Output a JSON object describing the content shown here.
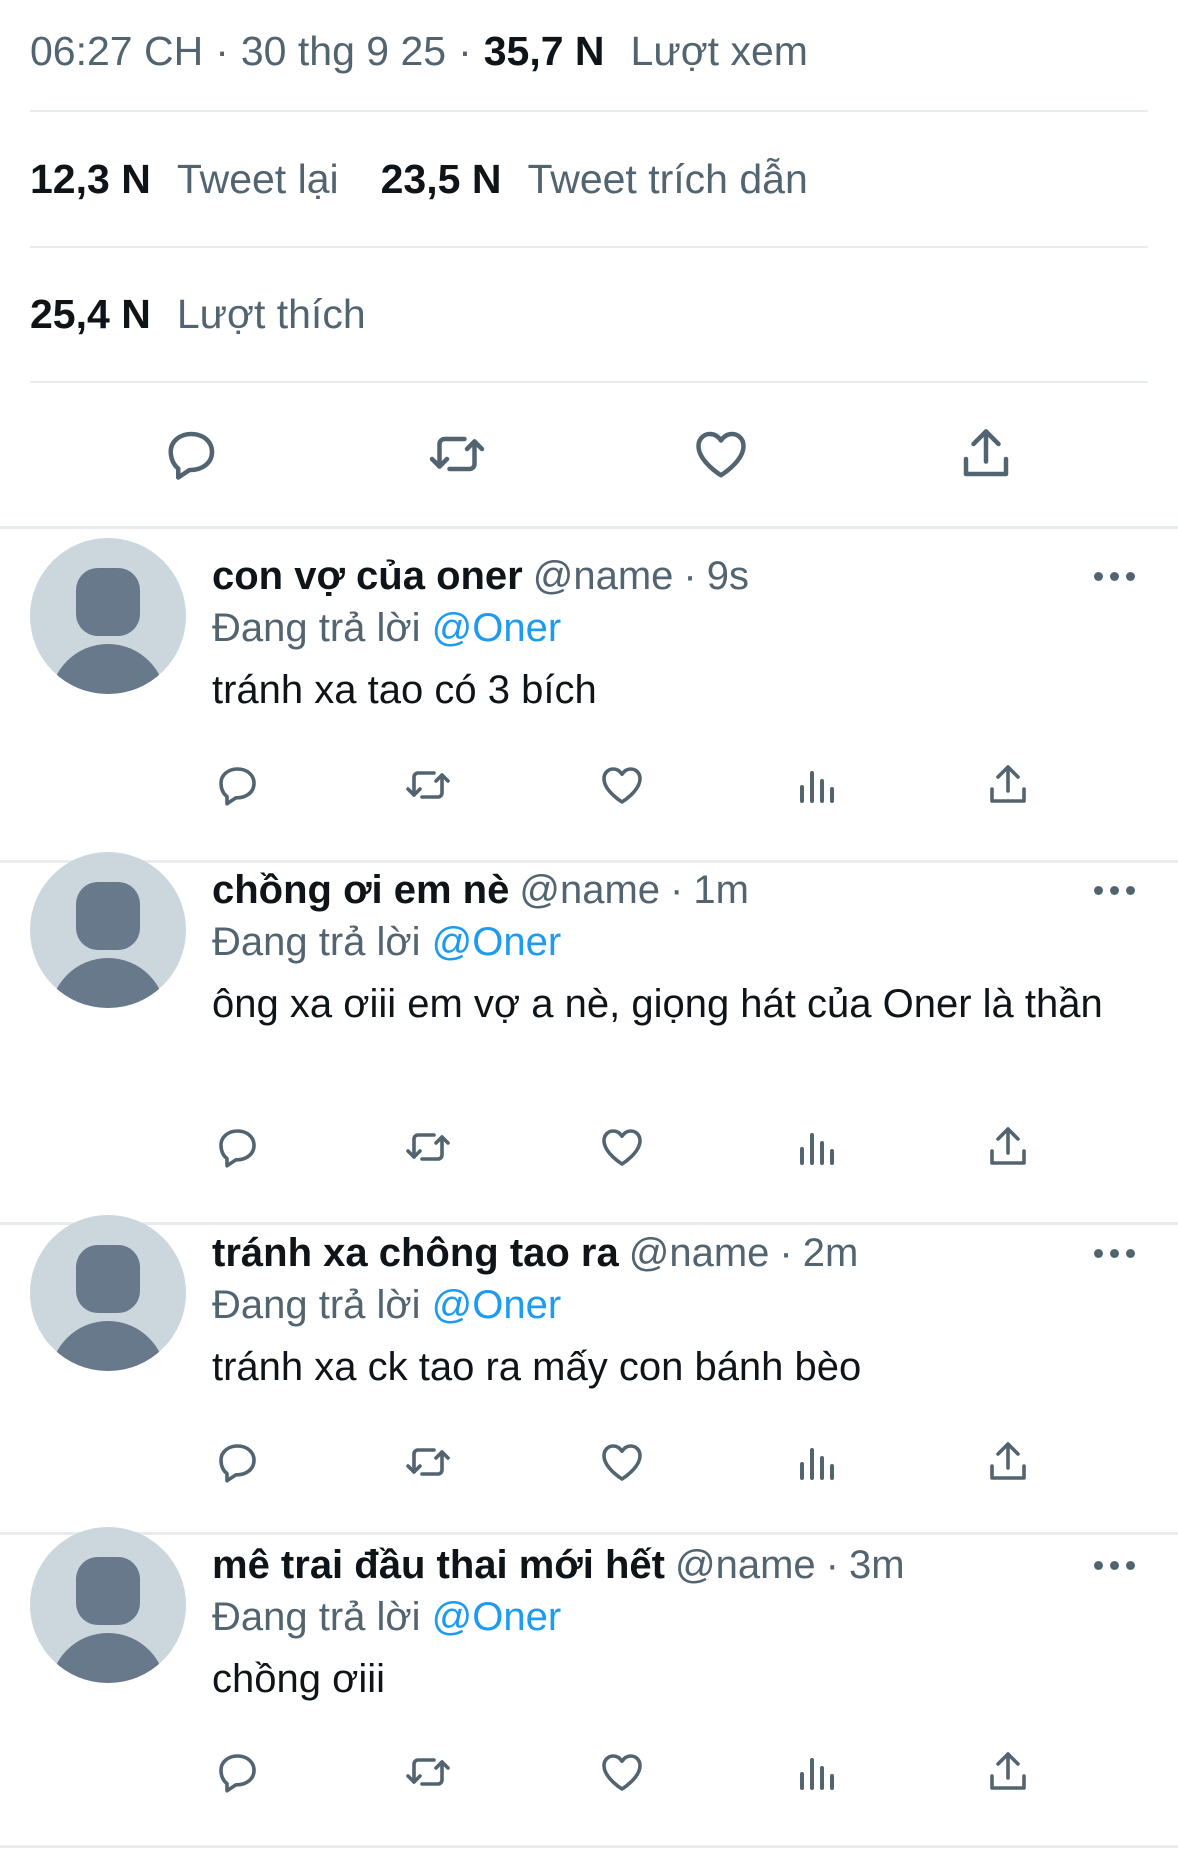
{
  "tweet_meta": {
    "time": "06:27 CH",
    "separator": "·",
    "date": "30 thg 9 25",
    "views_count": "35,7 N",
    "views_label": "Lượt xem"
  },
  "stats": {
    "retweets_count": "12,3 N",
    "retweets_label": "Tweet lại",
    "quotes_count": "23,5 N",
    "quotes_label": "Tweet trích dẫn",
    "likes_count": "25,4 N",
    "likes_label": "Lượt thích"
  },
  "icons": {
    "reply": "reply-icon",
    "retweet": "retweet-icon",
    "like": "heart-icon",
    "views": "analytics-icon",
    "share": "share-icon",
    "more": "more-icon"
  },
  "colors": {
    "accent": "#1d9bf0",
    "secondary_text": "#536471",
    "divider": "#e6ecf0"
  },
  "replies": [
    {
      "name": "con vợ của oner",
      "handle": "@name",
      "dot": "·",
      "time": "9s",
      "replying_prefix": "Đang trả lời",
      "replying_to": "@Oner",
      "text": "tránh xa tao có 3 bích"
    },
    {
      "name": "chồng ơi em nè",
      "handle": "@name",
      "dot": "·",
      "time": "1m",
      "replying_prefix": "Đang trả lời",
      "replying_to": "@Oner",
      "text": "ông xa ơiii em vợ a nè, giọng hát của Oner là thần"
    },
    {
      "name": "tránh xa chông tao ra",
      "handle": "@name",
      "dot": "·",
      "time": "2m",
      "replying_prefix": "Đang trả lời",
      "replying_to": "@Oner",
      "text": "tránh xa ck tao ra mấy con bánh bèo"
    },
    {
      "name": "mê trai đầu thai mới hết",
      "handle": "@name",
      "dot": "·",
      "time": "3m",
      "replying_prefix": "Đang trả lời",
      "replying_to": "@Oner",
      "text": "chồng ơiii"
    }
  ]
}
